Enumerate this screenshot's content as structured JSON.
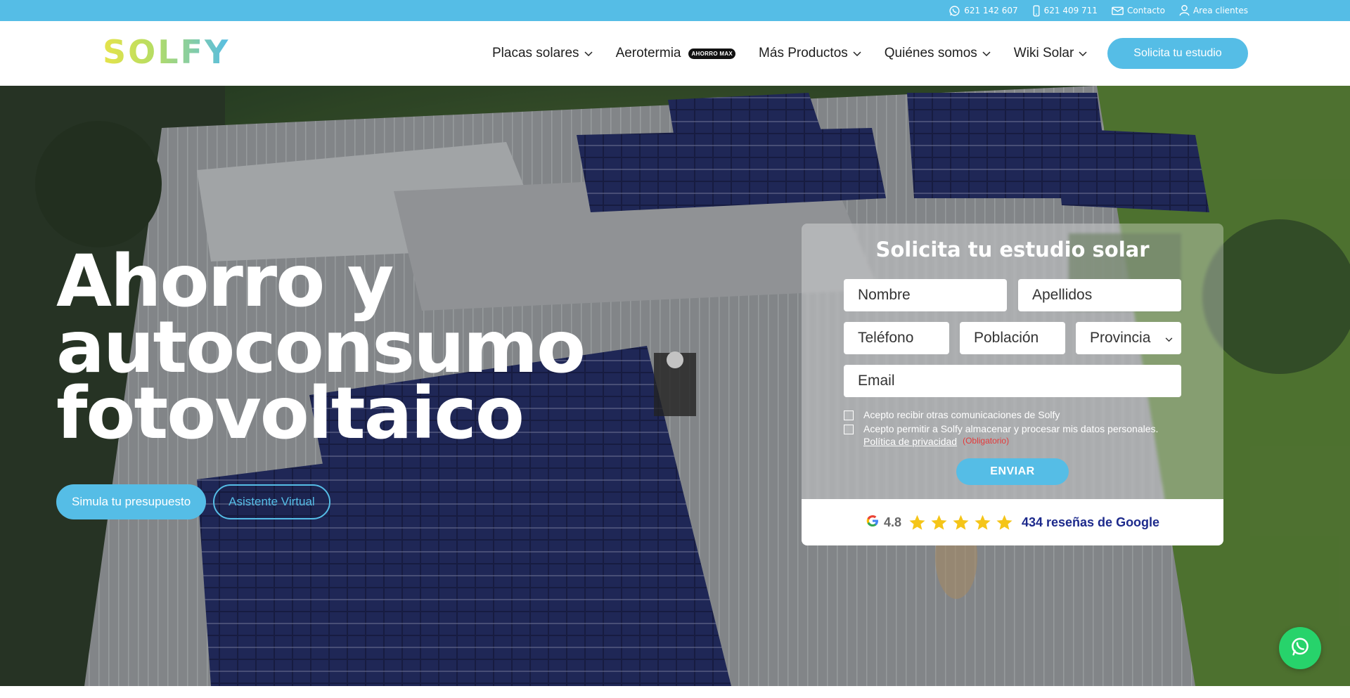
{
  "topbar": {
    "whatsapp_phone": "621 142 607",
    "mobile_phone": "621 409 711",
    "contact": "Contacto",
    "client_area": "Area clientes"
  },
  "header": {
    "logo": "SOLFY",
    "nav": [
      {
        "label": "Placas solares",
        "has_dropdown": true
      },
      {
        "label": "Aerotermia",
        "badge": "AHORRO MAX",
        "has_dropdown": false
      },
      {
        "label": "Más Productos",
        "has_dropdown": true
      },
      {
        "label": "Quiénes somos",
        "has_dropdown": true
      },
      {
        "label": "Wiki Solar",
        "has_dropdown": true
      }
    ],
    "cta": "Solicita tu estudio"
  },
  "hero": {
    "title_lines": [
      "Ahorro y",
      "autoconsumo",
      "fotovoltaico"
    ],
    "btn_simulate": "Simula tu presupuesto",
    "btn_assistant": "Asistente Virtual"
  },
  "form": {
    "title": "Solicita tu estudio solar",
    "placeholders": {
      "nombre": "Nombre",
      "apellidos": "Apellidos",
      "telefono": "Teléfono",
      "poblacion": "Población",
      "provincia": "Provincia",
      "email": "Email"
    },
    "check_comms": "Acepto recibir otras comunicaciones de Solfy",
    "check_data": "Acepto permitir a Solfy almacenar y procesar mis datos personales.",
    "privacy_link": "Política de privacidad",
    "required_note": "(Obligatorio)",
    "submit": "ENVIAR"
  },
  "reviews": {
    "rating": "4.8",
    "stars": 5,
    "count_text": "434 reseñas de Google"
  },
  "colors": {
    "accent": "#55bde6",
    "whatsapp": "#27d36b",
    "star": "#f5c518",
    "review_text": "#1d2a8c"
  }
}
